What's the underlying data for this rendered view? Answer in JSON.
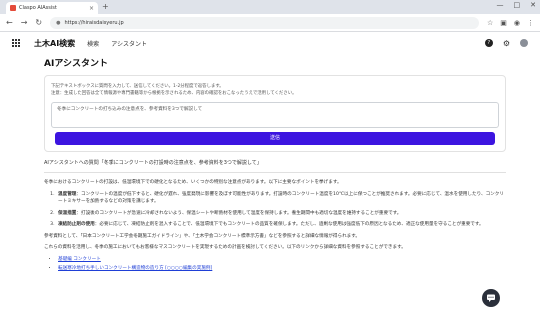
{
  "browser": {
    "tab_title": "Claspo AIAssist",
    "url": "https://hiraisdaisyeru.jp",
    "new_tab": "+",
    "close_tab": "×",
    "window_controls": [
      "—",
      "□",
      "✕"
    ]
  },
  "header": {
    "brand": "土木AI検索",
    "nav": [
      "検索",
      "アシスタント"
    ]
  },
  "main": {
    "title": "AIアシスタント",
    "hint_line1": "下記テキストボックスに質問を入力して、送信してください。1-2分程度で返答します。",
    "hint_line2": "注意：生成した回答は全て情報源や専門書籍等から根拠を示されるため、内容の確認をおこなったうえで活用してください。",
    "input_value": "冬季にコンクリートの打ち込みの注意点を、参考資料を3つで解説して",
    "send_label": "送信",
    "query_text": "AIアシスタントへの質問「冬季にコンクリートの打設時の注意点を、参考資料を3つで解説して」",
    "answer": {
      "intro": "冬季におけるコンクリートの打設は、低温環境下での硬化となるため、いくつかの特別な注意点があります。以下に主要なポイントを挙げます。",
      "items": [
        {
          "title": "温度管理",
          "text": "：コンクリートの温度が低下すると、硬化が遅れ、強度発現に影響を及ぼす可能性があります。打設時のコンクリート温度を10℃以上に保つことが推奨されます。必要に応じて、温水を使用したり、コンクリートミキサーを加熱するなどの対策を講じます。"
        },
        {
          "title": "保温措置",
          "text": "：打設後のコンクリートが急速に冷却されないよう、保温シートや断熱材を使用して温度を保持します。養生期間中も適切な温度を維持することが重要です。"
        },
        {
          "title": "凍結防止剤の使用",
          "text": "：必要に応じて、凍結防止剤を混入することで、低温環境下でもコンクリートの品質を確保します。ただし、過剰な使用は強度低下の原因となるため、適正な使用量を守ることが重要です。"
        }
      ],
      "ref_intro": "参考資料として、「日本コンクリート工学会冬期施工ガイドライン」や、「土木学会コンクリート標準示方書」などを参照すると詳細な情報が得られます。",
      "ref_note": "これらの資料を活用し、冬季の施工においてもお客様なマスコンクリートを実現するための計画を検討してください。以下のリンクから詳細な資料を参照することができます。",
      "links": [
        {
          "prefix": "",
          "label": "基礎編 コンクリート"
        },
        {
          "prefix": "",
          "label": "転送寒冷地打ち手しいコンクリート構造物の造り方 [○○○○編集の実施例]"
        }
      ]
    }
  },
  "colors": {
    "accent": "#3c14e0",
    "link": "#1f3fd6"
  }
}
